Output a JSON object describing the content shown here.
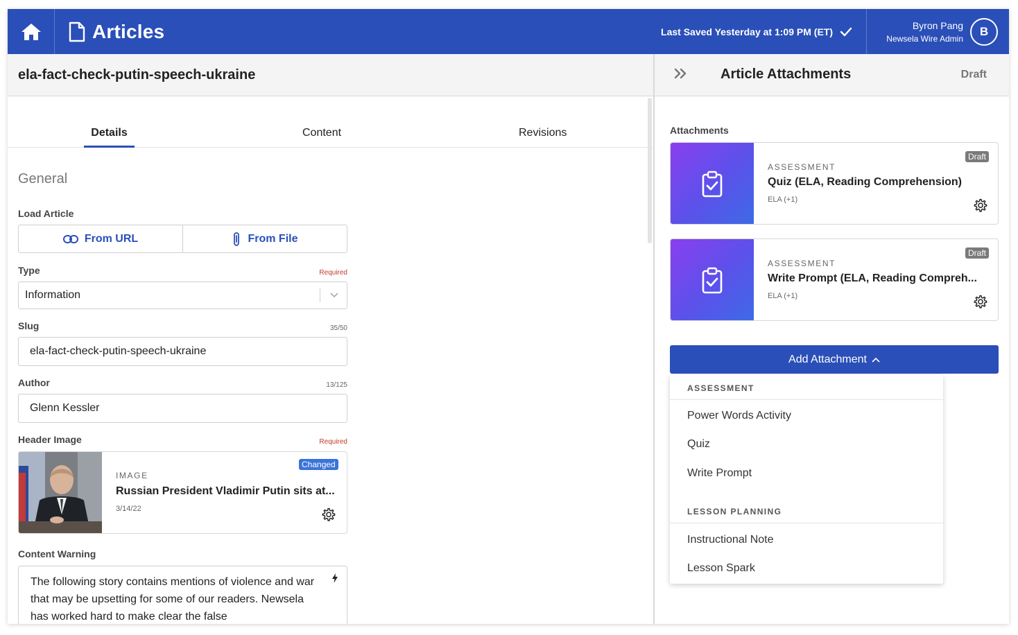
{
  "header": {
    "app_title": "Articles",
    "saved_status": "Last Saved Yesterday at 1:09 PM (ET)",
    "user_name": "Byron Pang",
    "user_role": "Newsela Wire Admin",
    "avatar_initial": "B"
  },
  "article": {
    "slug_title": "ela-fact-check-putin-speech-ukraine"
  },
  "tabs": [
    "Details",
    "Content",
    "Revisions"
  ],
  "general": {
    "heading": "General",
    "load_article": {
      "label": "Load Article",
      "from_url": "From URL",
      "from_file": "From File"
    },
    "type": {
      "label": "Type",
      "meta": "Required",
      "value": "Information"
    },
    "slug": {
      "label": "Slug",
      "meta": "35/50",
      "value": "ela-fact-check-putin-speech-ukraine"
    },
    "author": {
      "label": "Author",
      "meta": "13/125",
      "value": "Glenn Kessler"
    },
    "header_image": {
      "label": "Header Image",
      "meta": "Required",
      "kicker": "IMAGE",
      "title": "Russian President Vladimir Putin sits at...",
      "date": "3/14/22",
      "badge": "Changed"
    },
    "content_warning": {
      "label": "Content Warning",
      "value": "The following story contains mentions of violence and war that may be upsetting for some of our readers. Newsela has worked hard to make clear the false"
    }
  },
  "right_panel": {
    "title": "Article Attachments",
    "status": "Draft",
    "attachments_label": "Attachments",
    "attachments": [
      {
        "kicker": "ASSESSMENT",
        "title": "Quiz (ELA, Reading Comprehension)",
        "subject": "ELA (+1)",
        "badge": "Draft"
      },
      {
        "kicker": "ASSESSMENT",
        "title": "Write Prompt (ELA, Reading Compreh...",
        "subject": "ELA (+1)",
        "badge": "Draft"
      }
    ],
    "add_button": "Add Attachment",
    "menu": {
      "group1": "ASSESSMENT",
      "group1_items": [
        "Power Words Activity",
        "Quiz",
        "Write Prompt"
      ],
      "group2": "LESSON PLANNING",
      "group2_items": [
        "Instructional Note",
        "Lesson Spark"
      ]
    }
  },
  "colors": {
    "brand_blue": "#2a4fb8",
    "link_blue": "#2a4fb8",
    "required_red": "#c0392b",
    "badge_changed": "#3a73d9",
    "badge_draft": "#7a7a7a"
  },
  "icons": {
    "home": "home-icon",
    "document": "document-icon",
    "check": "check-icon",
    "link": "link-icon",
    "paperclip": "paperclip-icon",
    "chevron_down": "chevron-down-icon",
    "gear": "gear-icon",
    "clipboard": "clipboard-check-icon",
    "double_chevron": "double-chevron-right-icon",
    "chevron_up": "chevron-up-icon",
    "bolt": "bolt-icon"
  }
}
